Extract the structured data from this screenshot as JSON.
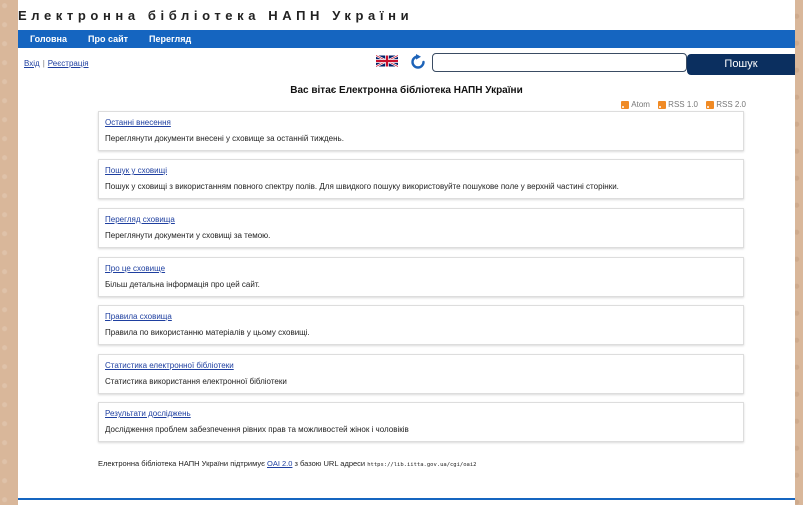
{
  "header": {
    "title": "Електронна бібліотека НАПН України"
  },
  "nav": {
    "items": [
      {
        "label": "Головна"
      },
      {
        "label": "Про сайт"
      },
      {
        "label": "Перегляд"
      }
    ],
    "color": "#1565c0"
  },
  "auth": {
    "login": "Вхід",
    "register": "Реєстрація",
    "separator": "|"
  },
  "search": {
    "value": "",
    "placeholder": "",
    "button_label": "Пошук"
  },
  "language": {
    "icon": "uk-flag-icon"
  },
  "welcome": "Вас вітає Електронна бібліотека НАПН України",
  "feeds": [
    {
      "label": "Atom",
      "icon": "rss-icon"
    },
    {
      "label": "RSS 1.0",
      "icon": "rss-icon"
    },
    {
      "label": "RSS 2.0",
      "icon": "rss-icon"
    }
  ],
  "panels": [
    {
      "link": "Останні внесення",
      "desc": "Переглянути документи внесені у сховище за останній тиждень."
    },
    {
      "link": "Пошук у сховищі",
      "desc": "Пошук у сховищі з використанням повного спектру полів. Для швидкого пошуку використовуйте пошукове поле у верхній частині сторінки."
    },
    {
      "link": "Перегляд сховища",
      "desc": "Переглянути документи у сховищі за темою."
    },
    {
      "link": "Про це сховище",
      "desc": "Більш детальна інформація про цей сайт."
    },
    {
      "link": "Правила сховища",
      "desc": "Правила по використанню матеріалів у цьому сховищі."
    },
    {
      "link": "Статистика електронної бібліотеки",
      "desc": "Статистика використання електронної бібліотеки"
    },
    {
      "link": "Результати досліджень",
      "desc": "Дослідження проблем забезпечення рівних прав та можливостей жінок і чоловіків"
    }
  ],
  "footer": {
    "text_before": "Електронна бібліотека НАПН України підтримує ",
    "oai_link": "OAI 2.0",
    "text_after": " з базою URL адреси ",
    "url": "https://lib.iitta.gov.ua/cgi/oai2"
  },
  "colors": {
    "accent": "#1565c0",
    "search_button": "#0b2f5f",
    "rss": "#f08a24"
  }
}
